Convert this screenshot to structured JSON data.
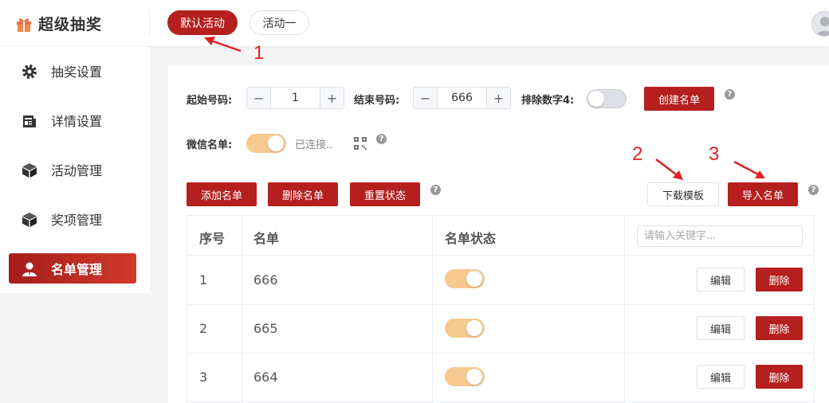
{
  "app": {
    "title": "超级抽奖"
  },
  "tabs": [
    {
      "label": "默认活动",
      "active": true
    },
    {
      "label": "活动一",
      "active": false
    }
  ],
  "sidebar": {
    "items": [
      {
        "label": "抽奖设置",
        "icon": "gear-icon"
      },
      {
        "label": "详情设置",
        "icon": "document-icon"
      },
      {
        "label": "活动管理",
        "icon": "box-icon"
      },
      {
        "label": "奖项管理",
        "icon": "box-icon"
      },
      {
        "label": "名单管理",
        "icon": "user-icon",
        "active": true
      }
    ]
  },
  "form": {
    "start_label": "起始号码:",
    "start_value": "1",
    "end_label": "结束号码:",
    "end_value": "666",
    "exclude4_label": "排除数字4:",
    "exclude4_on": false,
    "create_button": "创建名单",
    "wechat_label": "微信名单:",
    "wechat_on": true,
    "wechat_status": "已连接.."
  },
  "toolbar": {
    "add": "添加名单",
    "delete": "删除名单",
    "reset": "重置状态",
    "download_template": "下载模板",
    "import": "导入名单"
  },
  "table": {
    "headers": [
      "序号",
      "名单",
      "名单状态"
    ],
    "search_placeholder": "请输入关键字...",
    "rows": [
      {
        "index": "1",
        "name": "666",
        "status_on": true
      },
      {
        "index": "2",
        "name": "665",
        "status_on": true
      },
      {
        "index": "3",
        "name": "664",
        "status_on": true
      }
    ],
    "edit_label": "编辑",
    "delete_label": "删除"
  },
  "annotations": [
    "1",
    "2",
    "3"
  ],
  "colors": {
    "brand_red": "#b5201f",
    "switch_on": "#f6c98e",
    "annotation": "#e02020"
  }
}
